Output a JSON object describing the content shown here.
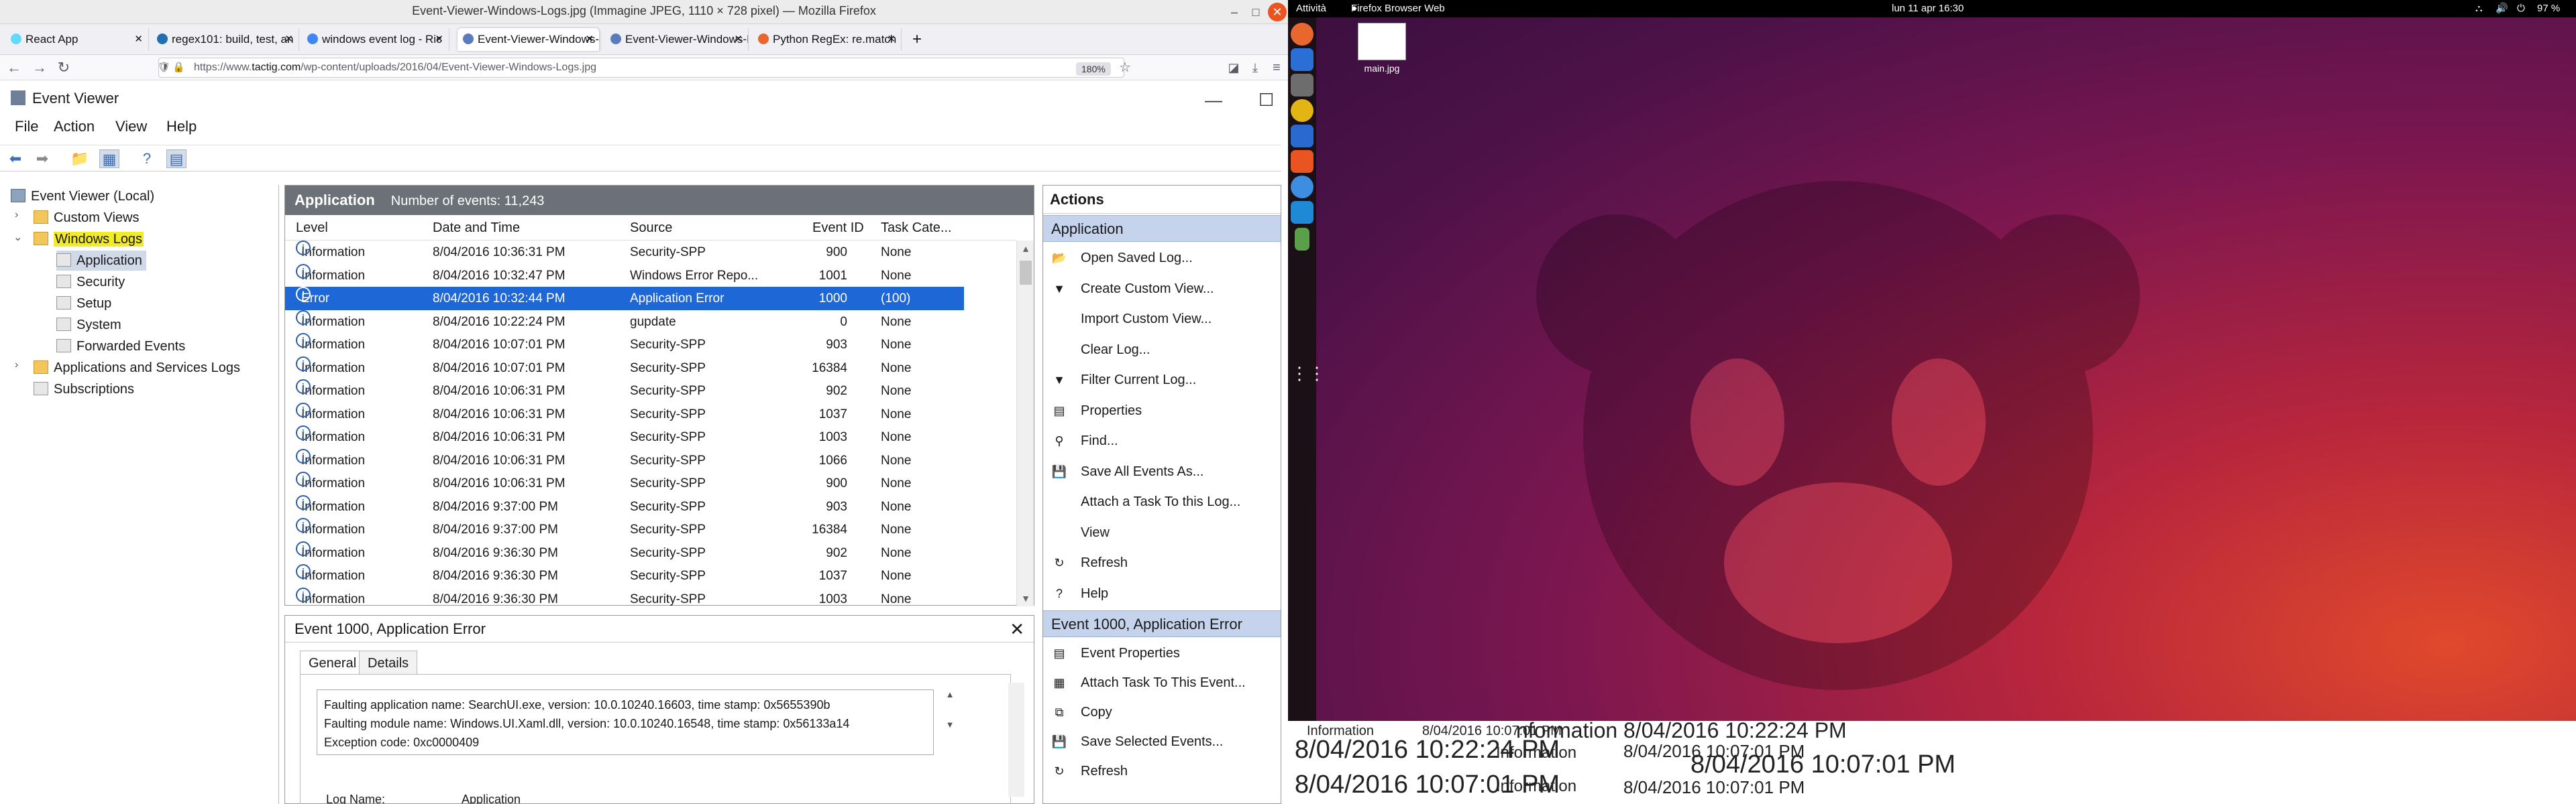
{
  "firefox": {
    "title": "Event-Viewer-Windows-Logs.jpg (Immagine JPEG, 1110 × 728 pixel) — Mozilla Firefox",
    "tabs": [
      {
        "label": "React App",
        "color": "#61dafb"
      },
      {
        "label": "regex101: build, test, an",
        "color": "#1f6fb2"
      },
      {
        "label": "windows event log - Ric",
        "color": "#4285f4"
      },
      {
        "label": "Event-Viewer-Windows-L",
        "color": "#5b7cbc"
      },
      {
        "label": "Event-Viewer-Windows-L",
        "color": "#5b7cbc"
      },
      {
        "label": "Python RegEx: re.match",
        "color": "#e8672e"
      }
    ],
    "url_prefix": "https://www.",
    "url_domain": "tactig.com",
    "url_path": "/wp-content/uploads/2016/04/Event-Viewer-Windows-Logs.jpg",
    "zoom": "180%"
  },
  "event_viewer": {
    "title": "Event Viewer",
    "menu": [
      "File",
      "Action",
      "View",
      "Help"
    ],
    "tree": {
      "root": "Event Viewer (Local)",
      "custom_views": "Custom Views",
      "windows_logs": "Windows Logs",
      "logs": [
        "Application",
        "Security",
        "Setup",
        "System",
        "Forwarded Events"
      ],
      "apps_services": "Applications and Services Logs",
      "subscriptions": "Subscriptions"
    },
    "list_header": {
      "name": "Application",
      "count": "Number of events: 11,243"
    },
    "columns": [
      "Level",
      "Date and Time",
      "Source",
      "Event ID",
      "Task Cate..."
    ],
    "events": [
      {
        "level": "Information",
        "datetime": "8/04/2016 10:36:31 PM",
        "source": "Security-SPP",
        "id": "900",
        "task": "None"
      },
      {
        "level": "Information",
        "datetime": "8/04/2016 10:32:47 PM",
        "source": "Windows Error Repo...",
        "id": "1001",
        "task": "None"
      },
      {
        "level": "Error",
        "datetime": "8/04/2016 10:32:44 PM",
        "source": "Application Error",
        "id": "1000",
        "task": "(100)"
      },
      {
        "level": "Information",
        "datetime": "8/04/2016 10:22:24 PM",
        "source": "gupdate",
        "id": "0",
        "task": "None"
      },
      {
        "level": "Information",
        "datetime": "8/04/2016 10:07:01 PM",
        "source": "Security-SPP",
        "id": "903",
        "task": "None"
      },
      {
        "level": "Information",
        "datetime": "8/04/2016 10:07:01 PM",
        "source": "Security-SPP",
        "id": "16384",
        "task": "None"
      },
      {
        "level": "Information",
        "datetime": "8/04/2016 10:06:31 PM",
        "source": "Security-SPP",
        "id": "902",
        "task": "None"
      },
      {
        "level": "Information",
        "datetime": "8/04/2016 10:06:31 PM",
        "source": "Security-SPP",
        "id": "1037",
        "task": "None"
      },
      {
        "level": "Information",
        "datetime": "8/04/2016 10:06:31 PM",
        "source": "Security-SPP",
        "id": "1003",
        "task": "None"
      },
      {
        "level": "Information",
        "datetime": "8/04/2016 10:06:31 PM",
        "source": "Security-SPP",
        "id": "1066",
        "task": "None"
      },
      {
        "level": "Information",
        "datetime": "8/04/2016 10:06:31 PM",
        "source": "Security-SPP",
        "id": "900",
        "task": "None"
      },
      {
        "level": "Information",
        "datetime": "8/04/2016 9:37:00 PM",
        "source": "Security-SPP",
        "id": "903",
        "task": "None"
      },
      {
        "level": "Information",
        "datetime": "8/04/2016 9:37:00 PM",
        "source": "Security-SPP",
        "id": "16384",
        "task": "None"
      },
      {
        "level": "Information",
        "datetime": "8/04/2016 9:36:30 PM",
        "source": "Security-SPP",
        "id": "902",
        "task": "None"
      },
      {
        "level": "Information",
        "datetime": "8/04/2016 9:36:30 PM",
        "source": "Security-SPP",
        "id": "1037",
        "task": "None"
      },
      {
        "level": "Information",
        "datetime": "8/04/2016 9:36:30 PM",
        "source": "Security-SPP",
        "id": "1003",
        "task": "None"
      }
    ],
    "detail": {
      "title": "Event 1000, Application Error",
      "tabs": [
        "General",
        "Details"
      ],
      "lines": [
        "Faulting application name: SearchUI.exe, version: 10.0.10240.16603, time stamp: 0x5655390b",
        "Faulting module name: Windows.UI.Xaml.dll, version: 10.0.10240.16548, time stamp: 0x56133a14",
        "Exception code: 0xc0000409"
      ],
      "log_name_label": "Log Name:",
      "log_name_value": "Application"
    },
    "actions": {
      "header": "Actions",
      "section1": "Application",
      "items1": [
        "Open Saved Log...",
        "Create Custom View...",
        "Import Custom View...",
        "Clear Log...",
        "Filter Current Log...",
        "Properties",
        "Find...",
        "Save All Events As...",
        "Attach a Task To this Log...",
        "View",
        "Refresh",
        "Help"
      ],
      "section2": "Event 1000, Application Error",
      "items2": [
        "Event Properties",
        "Attach Task To This Event...",
        "Copy",
        "Save Selected Events...",
        "Refresh"
      ]
    }
  },
  "ubuntu": {
    "activities": "Attività",
    "app_name": "Firefox Browser Web",
    "clock": "lun 11 apr  16:30",
    "battery": "97 %",
    "desktop_file": "main.jpg",
    "zoom_fragment": [
      "Information",
      "8/04/2016 10:07:01 PM",
      "nformation",
      "8/04/2016 10:22:24 PM",
      "8/04/2016 10:22:24 PM",
      "Information",
      "8/04/2016 10:07:01 PM",
      "8/04/2016 10:07:01 PM",
      "8/04/2016 10:07:01 PM",
      "Information",
      "8/04/2016 10:07:01 PM"
    ]
  }
}
